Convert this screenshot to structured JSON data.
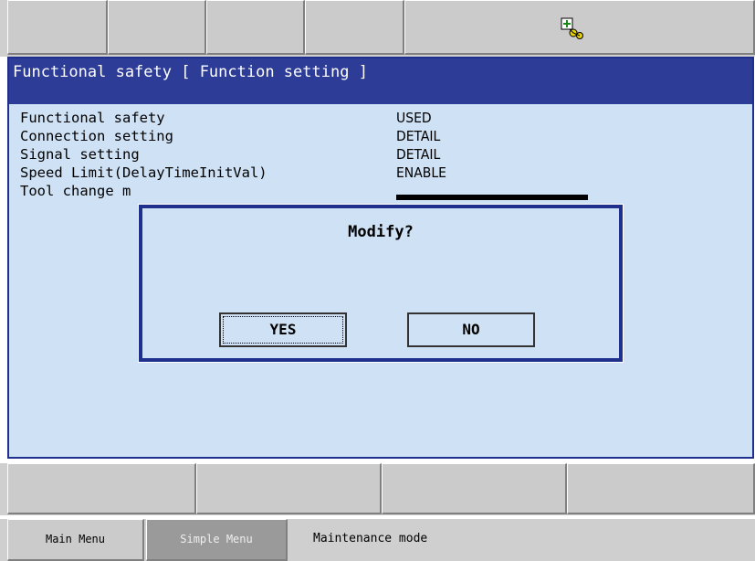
{
  "top_bar": {
    "tabs": [
      "",
      "",
      "",
      ""
    ],
    "status_icon": "tool-status-icon"
  },
  "window": {
    "title": "Functional safety [ Function setting ]",
    "rows": [
      {
        "label": "Functional safety",
        "value": "USED"
      },
      {
        "label": "Connection setting",
        "value": "DETAIL"
      },
      {
        "label": "Signal setting",
        "value": "DETAIL"
      },
      {
        "label": "Speed Limit(DelayTimeInitVal)",
        "value": "ENABLE"
      },
      {
        "label": "Tool change m",
        "value": ""
      }
    ]
  },
  "dialog": {
    "message": "Modify?",
    "yes_label": "YES",
    "no_label": "NO"
  },
  "menu_bar": {
    "main_menu": "Main Menu",
    "simple_menu": "Simple Menu",
    "mode": "Maintenance mode"
  },
  "colors": {
    "title_bar": "#2d3c97",
    "panel_bg": "#cfe1f4",
    "frame_border": "#1e2f8d"
  }
}
